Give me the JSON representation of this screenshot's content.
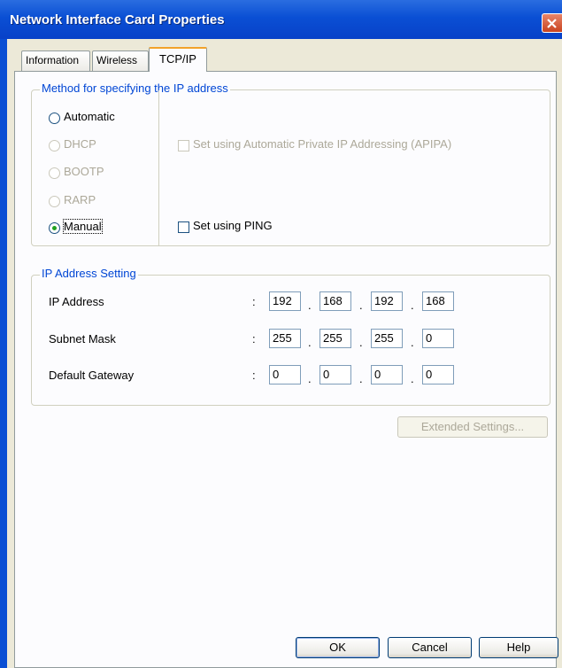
{
  "window": {
    "title": "Network Interface Card Properties"
  },
  "tabs": [
    {
      "label": "Information"
    },
    {
      "label": "Wireless"
    },
    {
      "label": "TCP/IP"
    }
  ],
  "method_group": {
    "legend": "Method for specifying the IP address",
    "options": [
      {
        "label": "Automatic",
        "selected": false,
        "enabled": true
      },
      {
        "label": "DHCP",
        "selected": false,
        "enabled": false
      },
      {
        "label": "BOOTP",
        "selected": false,
        "enabled": false
      },
      {
        "label": "RARP",
        "selected": false,
        "enabled": false
      },
      {
        "label": "Manual",
        "selected": true,
        "enabled": true
      }
    ],
    "apipa_label": "Set using Automatic Private IP Addressing (APIPA)",
    "ping_label": "Set using PING"
  },
  "ip_group": {
    "legend": "IP Address Setting",
    "separator": ":",
    "rows": [
      {
        "label": "IP Address",
        "octets": [
          "192",
          "168",
          "192",
          "168"
        ]
      },
      {
        "label": "Subnet Mask",
        "octets": [
          "255",
          "255",
          "255",
          "0"
        ]
      },
      {
        "label": "Default Gateway",
        "octets": [
          "0",
          "0",
          "0",
          "0"
        ]
      }
    ]
  },
  "buttons": {
    "extended": "Extended Settings...",
    "ok": "OK",
    "cancel": "Cancel",
    "help": "Help"
  },
  "colors": {
    "title_bar": "#0a4fd4",
    "group_legend": "#0046d5",
    "radio_selected": "#21a121"
  }
}
